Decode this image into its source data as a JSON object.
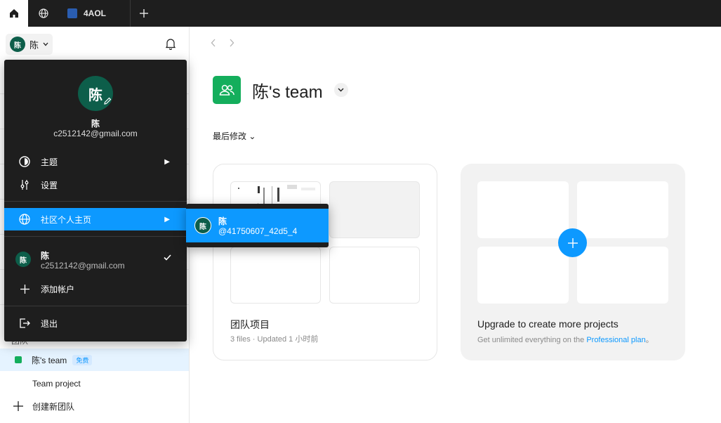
{
  "tabbar": {
    "file_tab_label": "4AOL"
  },
  "sidebar": {
    "user_name": "陈",
    "avatar_initial": "陈",
    "section_label": "团队",
    "team_name": "陈's team",
    "team_badge": "免费",
    "team_project": "Team project",
    "create_team": "创建新团队"
  },
  "main": {
    "team_title": "陈's team",
    "sort_label": "最后修改 ⌄",
    "project_card": {
      "title": "团队项目",
      "subtitle": "3 files · Updated 1 小时前"
    },
    "upgrade_card": {
      "title": "Upgrade to create more projects",
      "subtitle_prefix": "Get unlimited everything on the ",
      "link": "Professional plan",
      "subtitle_suffix": "。"
    }
  },
  "account_menu": {
    "avatar_initial": "陈",
    "name": "陈",
    "email": "c2512142@gmail.com",
    "theme": "主题",
    "settings": "设置",
    "community": "社区个人主页",
    "account_name": "陈",
    "account_email": "c2512142@gmail.com",
    "add_account": "添加帐户",
    "logout": "退出"
  },
  "community_submenu": {
    "avatar_initial": "陈",
    "name": "陈",
    "handle": "@41750607_42d5_4"
  },
  "colors": {
    "accent": "#0d99ff",
    "team_green": "#14ae5c",
    "avatar": "#0d5e4a",
    "menu_bg": "#1e1e1e"
  }
}
